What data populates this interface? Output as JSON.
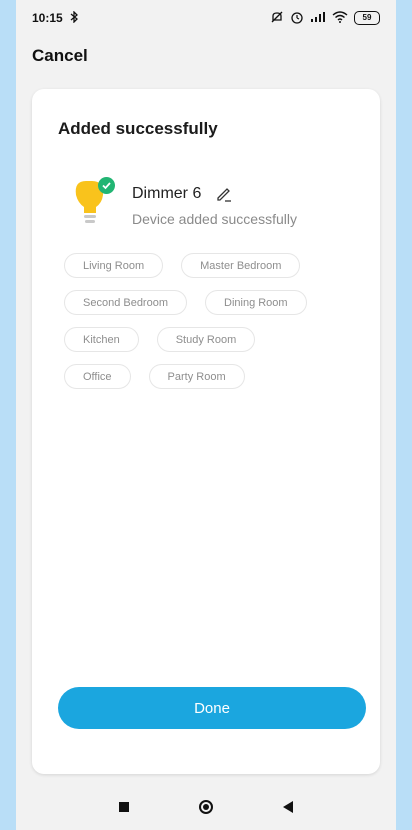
{
  "status_bar": {
    "time": "10:15",
    "bluetooth_icon": "bluetooth-icon",
    "battery_level": "59"
  },
  "header": {
    "cancel_label": "Cancel"
  },
  "card": {
    "title": "Added successfully",
    "device": {
      "name": "Dimmer 6",
      "subtitle": "Device added successfully",
      "icon": "bulb-icon",
      "status_icon": "check-icon"
    },
    "rooms": [
      [
        "Living Room",
        "Master Bedroom"
      ],
      [
        "Second Bedroom",
        "Dining Room"
      ],
      [
        "Kitchen",
        "Study Room"
      ],
      [
        "Office",
        "Party Room"
      ]
    ],
    "done_label": "Done"
  },
  "colors": {
    "accent": "#1ba6df",
    "success": "#22b573",
    "bulb": "#f9c31c",
    "background": "#b9def7"
  }
}
